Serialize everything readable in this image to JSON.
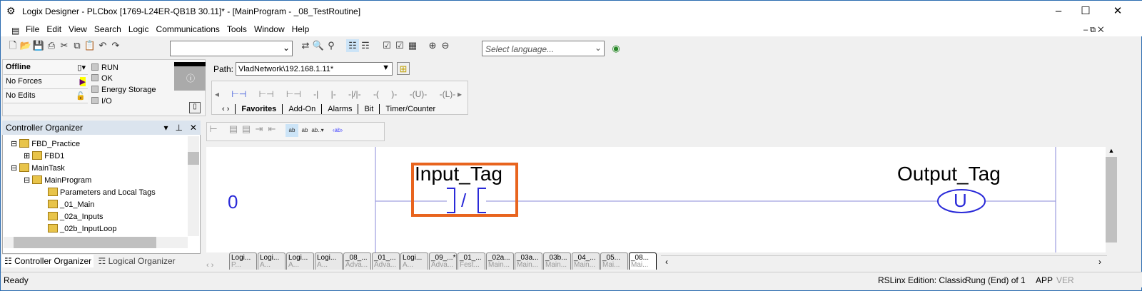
{
  "window": {
    "title": "Logix Designer - PLCbox [1769-L24ER-QB1B 30.11]* - [MainProgram - _08_TestRoutine]"
  },
  "menu": [
    "File",
    "Edit",
    "View",
    "Search",
    "Logic",
    "Communications",
    "Tools",
    "Window",
    "Help"
  ],
  "toolbar": {
    "search_value": "",
    "language_placeholder": "Select language..."
  },
  "status": {
    "mode": "Offline",
    "forces": "No Forces",
    "edits": "No Edits",
    "indicators": [
      "RUN",
      "OK",
      "Energy Storage",
      "I/O"
    ]
  },
  "path": {
    "label": "Path:",
    "value": "VladNetwork\\192.168.1.11*"
  },
  "instruction_palette": {
    "symbols": [
      "◂",
      "⊢⊣",
      "⊢⊣",
      "⊢⊣",
      "-| |-",
      "-|/|-",
      "-( )-",
      "-(U)-",
      "-(L)-"
    ],
    "tabs": [
      "Favorites",
      "Add-On",
      "Alarms",
      "Bit",
      "Timer/Counter"
    ]
  },
  "organizer": {
    "title": "Controller Organizer",
    "tree": [
      {
        "label": "FBD_Practice",
        "level": 1
      },
      {
        "label": "FBD1",
        "level": 2
      },
      {
        "label": "MainTask",
        "level": 1
      },
      {
        "label": "MainProgram",
        "level": 2
      },
      {
        "label": "Parameters and Local Tags",
        "level": 3
      },
      {
        "label": "_01_Main",
        "level": 3
      },
      {
        "label": "_02a_Inputs",
        "level": 3
      },
      {
        "label": "_02b_InputLoop",
        "level": 3
      }
    ],
    "tabs": [
      "Controller Organizer",
      "Logical Organizer"
    ]
  },
  "ladder": {
    "rung_number": "0",
    "input_tag": "Input_Tag",
    "input_symbol": "/",
    "output_tag": "Output_Tag",
    "output_symbol": "U",
    "highlight_color": "#e8641e",
    "wire_color": "#8a8ad8"
  },
  "routine_tabs": [
    {
      "top": "Logi...",
      "bottom": "P..."
    },
    {
      "top": "Logi...",
      "bottom": "A..."
    },
    {
      "top": "Logi...",
      "bottom": "A..."
    },
    {
      "top": "Logi...",
      "bottom": "A..."
    },
    {
      "top": "_08_...",
      "bottom": "Adva..."
    },
    {
      "top": "_01_...",
      "bottom": "Adva..."
    },
    {
      "top": "Logi...",
      "bottom": "A..."
    },
    {
      "top": "_09_...*",
      "bottom": "Adva..."
    },
    {
      "top": "_01_...",
      "bottom": "Fest..."
    },
    {
      "top": "_02a...",
      "bottom": "Main..."
    },
    {
      "top": "_03a...",
      "bottom": "Main..."
    },
    {
      "top": "_03b...",
      "bottom": "Main..."
    },
    {
      "top": "_04_...",
      "bottom": "Main..."
    },
    {
      "top": "_05...",
      "bottom": "Mai..."
    },
    {
      "top": "_08...",
      "bottom": "Mai..."
    }
  ],
  "statusbar": {
    "left": "Ready",
    "rslinx": "RSLinx Edition: Classic",
    "rung": "Rung (End) of 1",
    "app": "APP",
    "ver": "VER"
  }
}
